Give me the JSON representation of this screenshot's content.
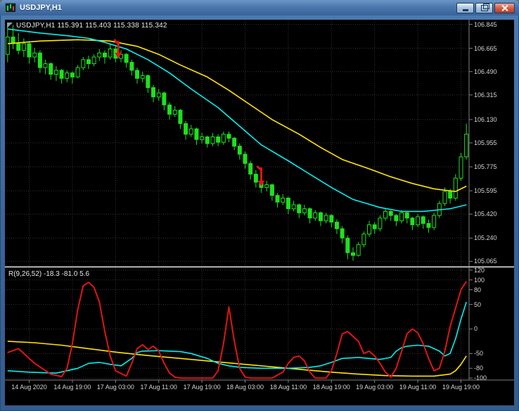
{
  "window": {
    "title": "USDJPY,H1",
    "controls": [
      "minimize",
      "restore",
      "close"
    ]
  },
  "main_chart": {
    "ohlc_label": "USDJPY,H1 115.391 115.403 115.338 115.342"
  },
  "indicator": {
    "label": "R(9,26,52) -18.3 -81.0 5.6"
  },
  "icons": {
    "app-icon": "mini-candlestick-chart",
    "minimize-icon": "underscore-bar",
    "restore-icon": "overlapping-squares",
    "close-icon": "cross",
    "sell-arrow-icon": "red-down-arrow",
    "one-click-trading-icon": "corner-triangle"
  },
  "chart_data": {
    "type": "candlestick",
    "symbol": "USDJPY",
    "timeframe": "H1",
    "main_range": [
      105.03,
      106.88
    ],
    "ind_range": [
      -104,
      124
    ],
    "price_axis_labels": [
      "106.845",
      "106.665",
      "106.490",
      "106.315",
      "106.130",
      "105.955",
      "105.775",
      "105.595",
      "105.420",
      "105.240",
      "105.065"
    ],
    "indicator_axis_labels": [
      "120",
      "100",
      "80",
      "50",
      "0",
      "-50",
      "-80",
      "-100"
    ],
    "time_labels": [
      "14 Aug 2020",
      "14 Aug 19:00",
      "17 Aug 03:00",
      "17 Aug 11:00",
      "17 Aug 19:00",
      "18 Aug 03:00",
      "18 Aug 11:00",
      "18 Aug 19:00",
      "19 Aug 03:00",
      "19 Aug 11:00",
      "19 Aug 19:00"
    ],
    "grid_bars": [
      4,
      12,
      20,
      28,
      36,
      44,
      52,
      60,
      68,
      76,
      84
    ],
    "candles": [
      [
        106.62,
        106.82,
        106.56,
        106.75
      ],
      [
        106.75,
        106.84,
        106.66,
        106.7
      ],
      [
        106.7,
        106.78,
        106.62,
        106.65
      ],
      [
        106.65,
        106.74,
        106.6,
        106.7
      ],
      [
        106.7,
        106.72,
        106.55,
        106.6
      ],
      [
        106.6,
        106.67,
        106.56,
        106.63
      ],
      [
        106.63,
        106.65,
        106.48,
        106.52
      ],
      [
        106.52,
        106.58,
        106.47,
        106.55
      ],
      [
        106.55,
        106.56,
        106.43,
        106.47
      ],
      [
        106.47,
        106.53,
        106.42,
        106.5
      ],
      [
        106.5,
        106.51,
        106.4,
        106.44
      ],
      [
        106.44,
        106.5,
        106.41,
        106.48
      ],
      [
        106.48,
        106.49,
        106.4,
        106.45
      ],
      [
        106.45,
        106.54,
        106.44,
        106.52
      ],
      [
        106.52,
        106.6,
        106.5,
        106.58
      ],
      [
        106.58,
        106.61,
        106.51,
        106.55
      ],
      [
        106.55,
        106.62,
        106.53,
        106.6
      ],
      [
        106.6,
        106.66,
        106.57,
        106.63
      ],
      [
        106.63,
        106.65,
        106.55,
        106.6
      ],
      [
        106.6,
        106.7,
        106.58,
        106.66
      ],
      [
        106.66,
        106.69,
        106.56,
        106.59
      ],
      [
        106.59,
        106.65,
        106.56,
        106.62
      ],
      [
        106.62,
        106.63,
        106.52,
        106.56
      ],
      [
        106.56,
        106.58,
        106.46,
        106.5
      ],
      [
        106.5,
        106.52,
        106.4,
        106.44
      ],
      [
        106.44,
        106.49,
        106.41,
        106.46
      ],
      [
        106.46,
        106.47,
        106.33,
        106.37
      ],
      [
        106.37,
        106.39,
        106.26,
        106.3
      ],
      [
        106.3,
        106.36,
        106.27,
        106.33
      ],
      [
        106.33,
        106.34,
        106.2,
        106.24
      ],
      [
        106.24,
        106.26,
        106.13,
        106.17
      ],
      [
        106.17,
        106.23,
        106.15,
        106.2
      ],
      [
        106.2,
        106.21,
        106.06,
        106.1
      ],
      [
        106.1,
        106.12,
        105.98,
        106.02
      ],
      [
        106.02,
        106.09,
        106.0,
        106.06
      ],
      [
        106.06,
        106.07,
        105.94,
        105.98
      ],
      [
        105.98,
        106.03,
        105.95,
        106.0
      ],
      [
        106.0,
        106.01,
        105.92,
        105.95
      ],
      [
        105.95,
        106.03,
        105.93,
        106.0
      ],
      [
        106.0,
        106.02,
        105.93,
        105.96
      ],
      [
        105.96,
        106.04,
        105.94,
        106.02
      ],
      [
        106.02,
        106.04,
        105.96,
        105.99
      ],
      [
        105.99,
        106.0,
        105.9,
        105.93
      ],
      [
        105.93,
        105.95,
        105.83,
        105.87
      ],
      [
        105.87,
        105.89,
        105.76,
        105.8
      ],
      [
        105.8,
        105.82,
        105.68,
        105.72
      ],
      [
        105.72,
        105.75,
        105.62,
        105.66
      ],
      [
        105.66,
        105.7,
        105.58,
        105.62
      ],
      [
        105.62,
        105.67,
        105.59,
        105.64
      ],
      [
        105.64,
        105.65,
        105.52,
        105.56
      ],
      [
        105.56,
        105.58,
        105.47,
        105.51
      ],
      [
        105.51,
        105.57,
        105.49,
        105.54
      ],
      [
        105.54,
        105.55,
        105.42,
        105.46
      ],
      [
        105.46,
        105.52,
        105.44,
        105.49
      ],
      [
        105.49,
        105.5,
        105.39,
        105.43
      ],
      [
        105.43,
        105.49,
        105.41,
        105.46
      ],
      [
        105.46,
        105.47,
        105.35,
        105.39
      ],
      [
        105.39,
        105.45,
        105.37,
        105.43
      ],
      [
        105.43,
        105.44,
        105.33,
        105.37
      ],
      [
        105.37,
        105.43,
        105.35,
        105.41
      ],
      [
        105.41,
        105.42,
        105.32,
        105.36
      ],
      [
        105.36,
        105.38,
        105.27,
        105.31
      ],
      [
        105.31,
        105.33,
        105.2,
        105.24
      ],
      [
        105.24,
        105.26,
        105.08,
        105.13
      ],
      [
        105.13,
        105.17,
        105.07,
        105.11
      ],
      [
        105.11,
        105.21,
        105.1,
        105.19
      ],
      [
        105.19,
        105.29,
        105.17,
        105.27
      ],
      [
        105.27,
        105.37,
        105.25,
        105.34
      ],
      [
        105.34,
        105.36,
        105.27,
        105.31
      ],
      [
        105.31,
        105.41,
        105.29,
        105.39
      ],
      [
        105.39,
        105.46,
        105.37,
        105.44
      ],
      [
        105.44,
        105.45,
        105.37,
        105.41
      ],
      [
        105.41,
        105.42,
        105.33,
        105.37
      ],
      [
        105.37,
        105.45,
        105.35,
        105.43
      ],
      [
        105.43,
        105.44,
        105.35,
        105.39
      ],
      [
        105.39,
        105.4,
        105.3,
        105.34
      ],
      [
        105.34,
        105.42,
        105.32,
        105.4
      ],
      [
        105.4,
        105.41,
        105.31,
        105.35
      ],
      [
        105.35,
        105.38,
        105.28,
        105.32
      ],
      [
        105.32,
        105.43,
        105.3,
        105.41
      ],
      [
        105.41,
        105.52,
        105.39,
        105.5
      ],
      [
        105.5,
        105.62,
        105.48,
        105.59
      ],
      [
        105.59,
        105.61,
        105.5,
        105.54
      ],
      [
        105.54,
        105.72,
        105.52,
        105.69
      ],
      [
        105.69,
        105.88,
        105.67,
        105.85
      ],
      [
        105.85,
        106.1,
        105.83,
        106.02
      ]
    ],
    "ma_yellow": [
      [
        0,
        106.7
      ],
      [
        6,
        106.72
      ],
      [
        13,
        106.73
      ],
      [
        19,
        106.72
      ],
      [
        24,
        106.68
      ],
      [
        28,
        106.62
      ],
      [
        32,
        106.54
      ],
      [
        37,
        106.45
      ],
      [
        41,
        106.35
      ],
      [
        45,
        106.24
      ],
      [
        49,
        106.13
      ],
      [
        54,
        106.02
      ],
      [
        58,
        105.92
      ],
      [
        62,
        105.83
      ],
      [
        67,
        105.76
      ],
      [
        71,
        105.7
      ],
      [
        75,
        105.65
      ],
      [
        79,
        105.61
      ],
      [
        83,
        105.59
      ],
      [
        85,
        105.63
      ]
    ],
    "ma_cyan": [
      [
        0,
        106.81
      ],
      [
        6,
        106.78
      ],
      [
        11,
        106.76
      ],
      [
        15,
        106.74
      ],
      [
        18,
        106.71
      ],
      [
        22,
        106.66
      ],
      [
        26,
        106.58
      ],
      [
        30,
        106.48
      ],
      [
        34,
        106.36
      ],
      [
        39,
        106.22
      ],
      [
        43,
        106.08
      ],
      [
        47,
        105.94
      ],
      [
        52,
        105.82
      ],
      [
        56,
        105.72
      ],
      [
        60,
        105.62
      ],
      [
        64,
        105.53
      ],
      [
        69,
        105.47
      ],
      [
        73,
        105.44
      ],
      [
        77,
        105.44
      ],
      [
        82,
        105.46
      ],
      [
        85,
        105.49
      ]
    ],
    "arrows": [
      {
        "bar": 20.5,
        "from": 106.72,
        "to": 106.6
      },
      {
        "bar": 47,
        "from": 105.77,
        "to": 105.64
      }
    ],
    "ind_red": [
      [
        0,
        -48
      ],
      [
        2,
        -40
      ],
      [
        3,
        -50
      ],
      [
        5,
        -70
      ],
      [
        8,
        -92
      ],
      [
        10,
        -97
      ],
      [
        11,
        -80
      ],
      [
        12,
        -30
      ],
      [
        13,
        40
      ],
      [
        14,
        88
      ],
      [
        15,
        95
      ],
      [
        16,
        85
      ],
      [
        17,
        55
      ],
      [
        18,
        -5
      ],
      [
        19,
        -55
      ],
      [
        20,
        -85
      ],
      [
        22,
        -96
      ],
      [
        23,
        -70
      ],
      [
        24,
        -40
      ],
      [
        25,
        -32
      ],
      [
        26,
        -42
      ],
      [
        27,
        -35
      ],
      [
        28,
        -45
      ],
      [
        29,
        -70
      ],
      [
        30,
        -90
      ],
      [
        31,
        -98
      ],
      [
        32,
        -100
      ],
      [
        38,
        -100
      ],
      [
        39,
        -85
      ],
      [
        40,
        -30
      ],
      [
        41,
        45
      ],
      [
        42,
        -25
      ],
      [
        43,
        -80
      ],
      [
        44,
        -98
      ],
      [
        45,
        -100
      ],
      [
        49,
        -100
      ],
      [
        51,
        -88
      ],
      [
        52,
        -70
      ],
      [
        53,
        -58
      ],
      [
        54,
        -55
      ],
      [
        55,
        -65
      ],
      [
        56,
        -88
      ],
      [
        57,
        -100
      ],
      [
        59,
        -100
      ],
      [
        60,
        -85
      ],
      [
        61,
        -50
      ],
      [
        62,
        -10
      ],
      [
        63,
        -5
      ],
      [
        65,
        -25
      ],
      [
        66,
        -50
      ],
      [
        67,
        -45
      ],
      [
        68,
        -55
      ],
      [
        69,
        -70
      ],
      [
        70,
        -88
      ],
      [
        71,
        -98
      ],
      [
        72,
        -80
      ],
      [
        73,
        -45
      ],
      [
        74,
        -10
      ],
      [
        75,
        0
      ],
      [
        76,
        -8
      ],
      [
        77,
        -30
      ],
      [
        78,
        -60
      ],
      [
        79,
        -85
      ],
      [
        80,
        -80
      ],
      [
        81,
        -45
      ],
      [
        82,
        5
      ],
      [
        84,
        80
      ],
      [
        85,
        97
      ]
    ],
    "ind_cyan": [
      [
        0,
        -85
      ],
      [
        4,
        -88
      ],
      [
        9,
        -90
      ],
      [
        13,
        -80
      ],
      [
        15,
        -70
      ],
      [
        17,
        -68
      ],
      [
        19,
        -72
      ],
      [
        21,
        -75
      ],
      [
        23,
        -60
      ],
      [
        24,
        -48
      ],
      [
        25,
        -45
      ],
      [
        28,
        -44
      ],
      [
        30,
        -45
      ],
      [
        32,
        -46
      ],
      [
        34,
        -50
      ],
      [
        37,
        -60
      ],
      [
        39,
        -70
      ],
      [
        41,
        -75
      ],
      [
        43,
        -78
      ],
      [
        47,
        -80
      ],
      [
        52,
        -80
      ],
      [
        56,
        -78
      ],
      [
        58,
        -75
      ],
      [
        60,
        -68
      ],
      [
        62,
        -60
      ],
      [
        65,
        -58
      ],
      [
        67,
        -60
      ],
      [
        69,
        -62
      ],
      [
        71,
        -58
      ],
      [
        72,
        -45
      ],
      [
        73,
        -38
      ],
      [
        74,
        -35
      ],
      [
        76,
        -33
      ],
      [
        78,
        -35
      ],
      [
        80,
        -45
      ],
      [
        81,
        -55
      ],
      [
        82,
        -50
      ],
      [
        83,
        -20
      ],
      [
        84,
        20
      ],
      [
        85,
        55
      ]
    ],
    "ind_yellow": [
      [
        0,
        -25
      ],
      [
        5,
        -28
      ],
      [
        10,
        -33
      ],
      [
        15,
        -40
      ],
      [
        20,
        -47
      ],
      [
        25,
        -53
      ],
      [
        30,
        -58
      ],
      [
        35,
        -63
      ],
      [
        40,
        -68
      ],
      [
        45,
        -73
      ],
      [
        50,
        -78
      ],
      [
        55,
        -83
      ],
      [
        60,
        -88
      ],
      [
        65,
        -92
      ],
      [
        70,
        -95
      ],
      [
        75,
        -96
      ],
      [
        79,
        -96
      ],
      [
        82,
        -92
      ],
      [
        83,
        -85
      ],
      [
        84,
        -72
      ],
      [
        85,
        -55
      ]
    ],
    "colors": {
      "background": "#000000",
      "candle": "#1fe01f",
      "bull_fill": "#000000",
      "yellow": "#ffe400",
      "cyan": "#00f0f0",
      "red": "#e01515",
      "grid": "#353535",
      "frame": "#808080",
      "axis_text": "#d4d4d4"
    }
  }
}
